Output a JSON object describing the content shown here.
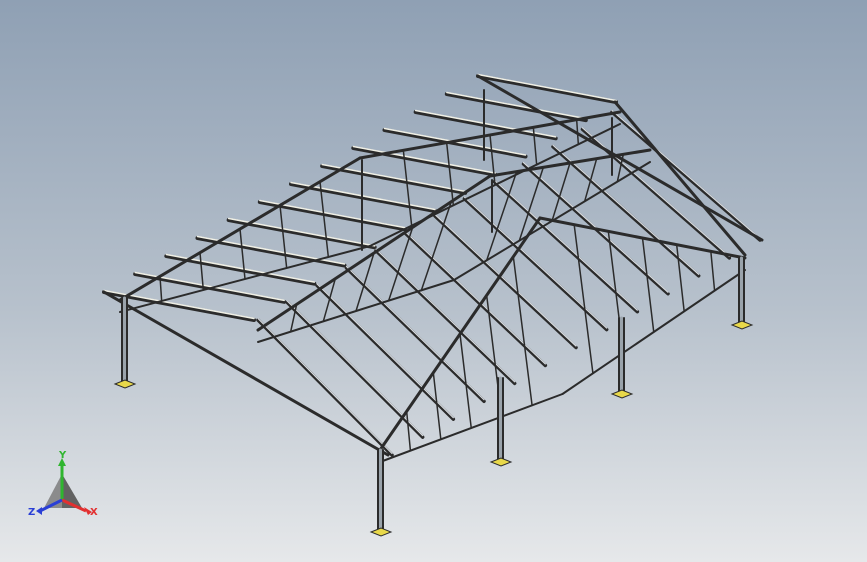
{
  "view": {
    "background_top": "#8fa0b4",
    "background_bottom": "#e6e8ea",
    "model_color": "#2b2b2b",
    "rafter_highlight": "#f0f0e6",
    "baseplate_color": "#e8d84a"
  },
  "triad": {
    "x_label": "X",
    "y_label": "Y",
    "z_label": "Z",
    "x_color": "#e23030",
    "y_color": "#2fb52f",
    "z_color": "#2a3fd6"
  }
}
